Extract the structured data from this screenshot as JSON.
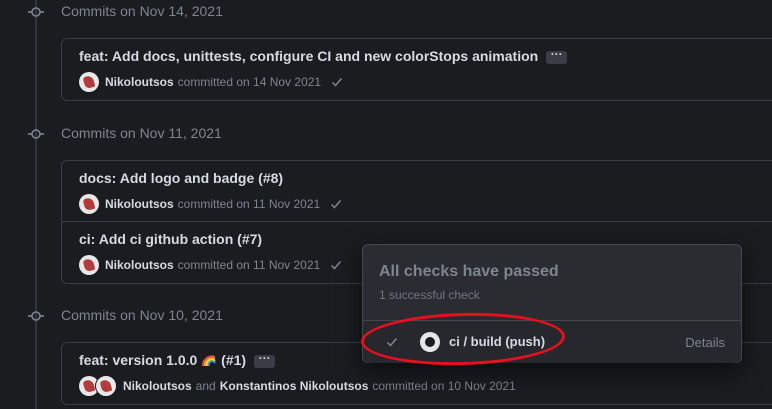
{
  "groups": [
    {
      "title": "Commits on Nov 14, 2021",
      "commits": [
        {
          "title": "feat: Add docs, unittests, configure CI and new colorStops animation",
          "ellipsis": "···",
          "author": "Nikoloutsos",
          "action": "committed on 14 Nov 2021"
        }
      ]
    },
    {
      "title": "Commits on Nov 11, 2021",
      "commits": [
        {
          "title": "docs: Add logo and badge (",
          "pr": "#8",
          "title_end": ")",
          "author": "Nikoloutsos",
          "action": "committed on 11 Nov 2021"
        },
        {
          "title": "ci: Add ci github action (",
          "pr": "#7",
          "title_end": ")",
          "author": "Nikoloutsos",
          "action": "committed on 11 Nov 2021"
        }
      ]
    },
    {
      "title": "Commits on Nov 10, 2021",
      "commits": [
        {
          "title": "feat: version 1.0.0",
          "title_after_emoji": " (",
          "pr": "#1",
          "title_end": ")",
          "ellipsis": "···",
          "author": "Nikoloutsos",
          "and_word": "and",
          "coauthor": "Konstantinos Nikoloutsos",
          "action": "committed on 10 Nov 2021"
        }
      ]
    }
  ],
  "popover": {
    "title": "All checks have passed",
    "subtitle": "1 successful check",
    "check_name": "ci / build (push)",
    "details_label": "Details"
  },
  "icons": {
    "group_node": "commit-node-icon",
    "check": "check-icon",
    "github": "github-icon",
    "rainbow": "rainbow-emoji-icon"
  },
  "colors": {
    "background": "#1b1c20",
    "highlight": "#e8101c",
    "muted_text": "#7d8590"
  }
}
